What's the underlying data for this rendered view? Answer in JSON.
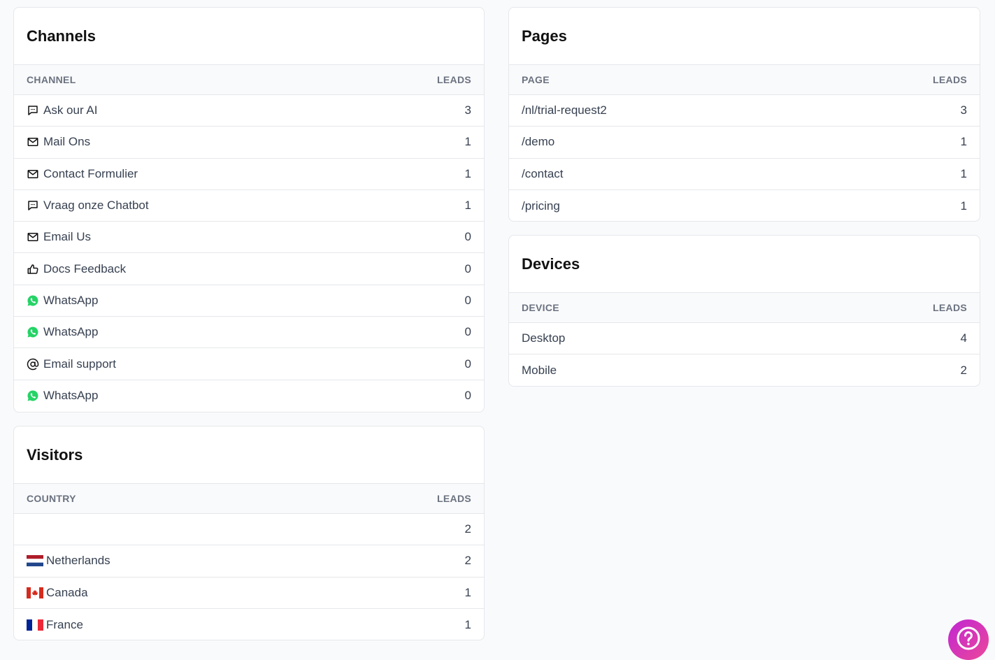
{
  "channels": {
    "title": "Channels",
    "col_left": "CHANNEL",
    "col_right": "LEADS",
    "rows": [
      {
        "label": "Ask our AI",
        "value": "3",
        "icon": "chat-icon"
      },
      {
        "label": "Mail Ons",
        "value": "1",
        "icon": "envelope-icon"
      },
      {
        "label": "Contact Formulier",
        "value": "1",
        "icon": "envelope-icon"
      },
      {
        "label": "Vraag onze Chatbot",
        "value": "1",
        "icon": "chat-icon"
      },
      {
        "label": "Email Us",
        "value": "0",
        "icon": "envelope-icon"
      },
      {
        "label": "Docs Feedback",
        "value": "0",
        "icon": "thumbs-up-icon"
      },
      {
        "label": "WhatsApp",
        "value": "0",
        "icon": "whatsapp-icon"
      },
      {
        "label": "WhatsApp",
        "value": "0",
        "icon": "whatsapp-icon"
      },
      {
        "label": "Email support",
        "value": "0",
        "icon": "at-sign-icon"
      },
      {
        "label": "WhatsApp",
        "value": "0",
        "icon": "whatsapp-icon"
      }
    ]
  },
  "visitors": {
    "title": "Visitors",
    "col_left": "COUNTRY",
    "col_right": "LEADS",
    "rows": [
      {
        "label": "",
        "value": "2",
        "flag": ""
      },
      {
        "label": "Netherlands",
        "value": "2",
        "flag": "netherlands-flag-icon"
      },
      {
        "label": "Canada",
        "value": "1",
        "flag": "canada-flag-icon"
      },
      {
        "label": "France",
        "value": "1",
        "flag": "france-flag-icon"
      }
    ]
  },
  "pages": {
    "title": "Pages",
    "col_left": "PAGE",
    "col_right": "LEADS",
    "rows": [
      {
        "label": "/nl/trial-request2",
        "value": "3"
      },
      {
        "label": "/demo",
        "value": "1"
      },
      {
        "label": "/contact",
        "value": "1"
      },
      {
        "label": "/pricing",
        "value": "1"
      }
    ]
  },
  "devices": {
    "title": "Devices",
    "col_left": "DEVICE",
    "col_right": "LEADS",
    "rows": [
      {
        "label": "Desktop",
        "value": "4"
      },
      {
        "label": "Mobile",
        "value": "2"
      }
    ]
  },
  "help": {
    "icon": "question-mark-icon"
  },
  "colors": {
    "whatsapp": "#25D366",
    "help_gradient_start": "#c026d3",
    "help_gradient_end": "#ec4899"
  }
}
